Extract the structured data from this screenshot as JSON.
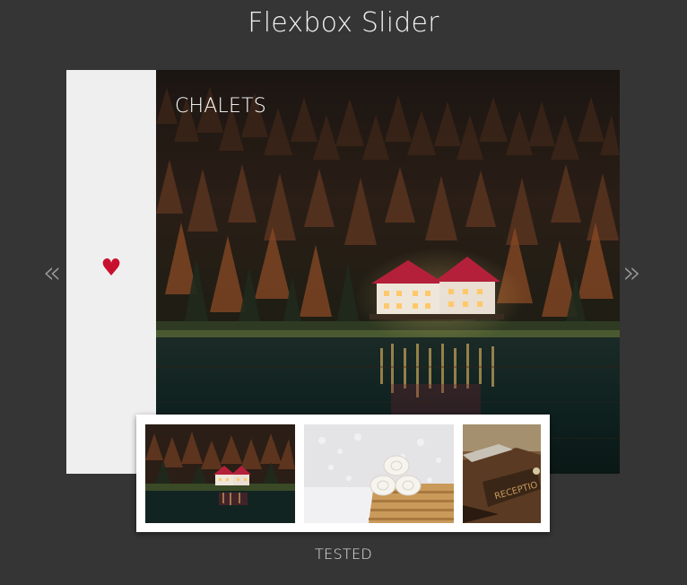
{
  "header": {
    "title": "Flexbox Slider"
  },
  "slider": {
    "current_caption": "CHALETS",
    "favorite_icon": "heart-icon",
    "prev_label": "«",
    "next_label": "»",
    "accent_color": "#c8102e"
  },
  "thumbnails": [
    {
      "subject": "chalets-by-lake",
      "icon": "thumbnail-chalets"
    },
    {
      "subject": "rolled-towels-on-bath-tray",
      "icon": "thumbnail-towels"
    },
    {
      "subject": "reception-sign-on-desk",
      "icon": "thumbnail-reception"
    }
  ],
  "footer": {
    "caption": "TESTED"
  }
}
